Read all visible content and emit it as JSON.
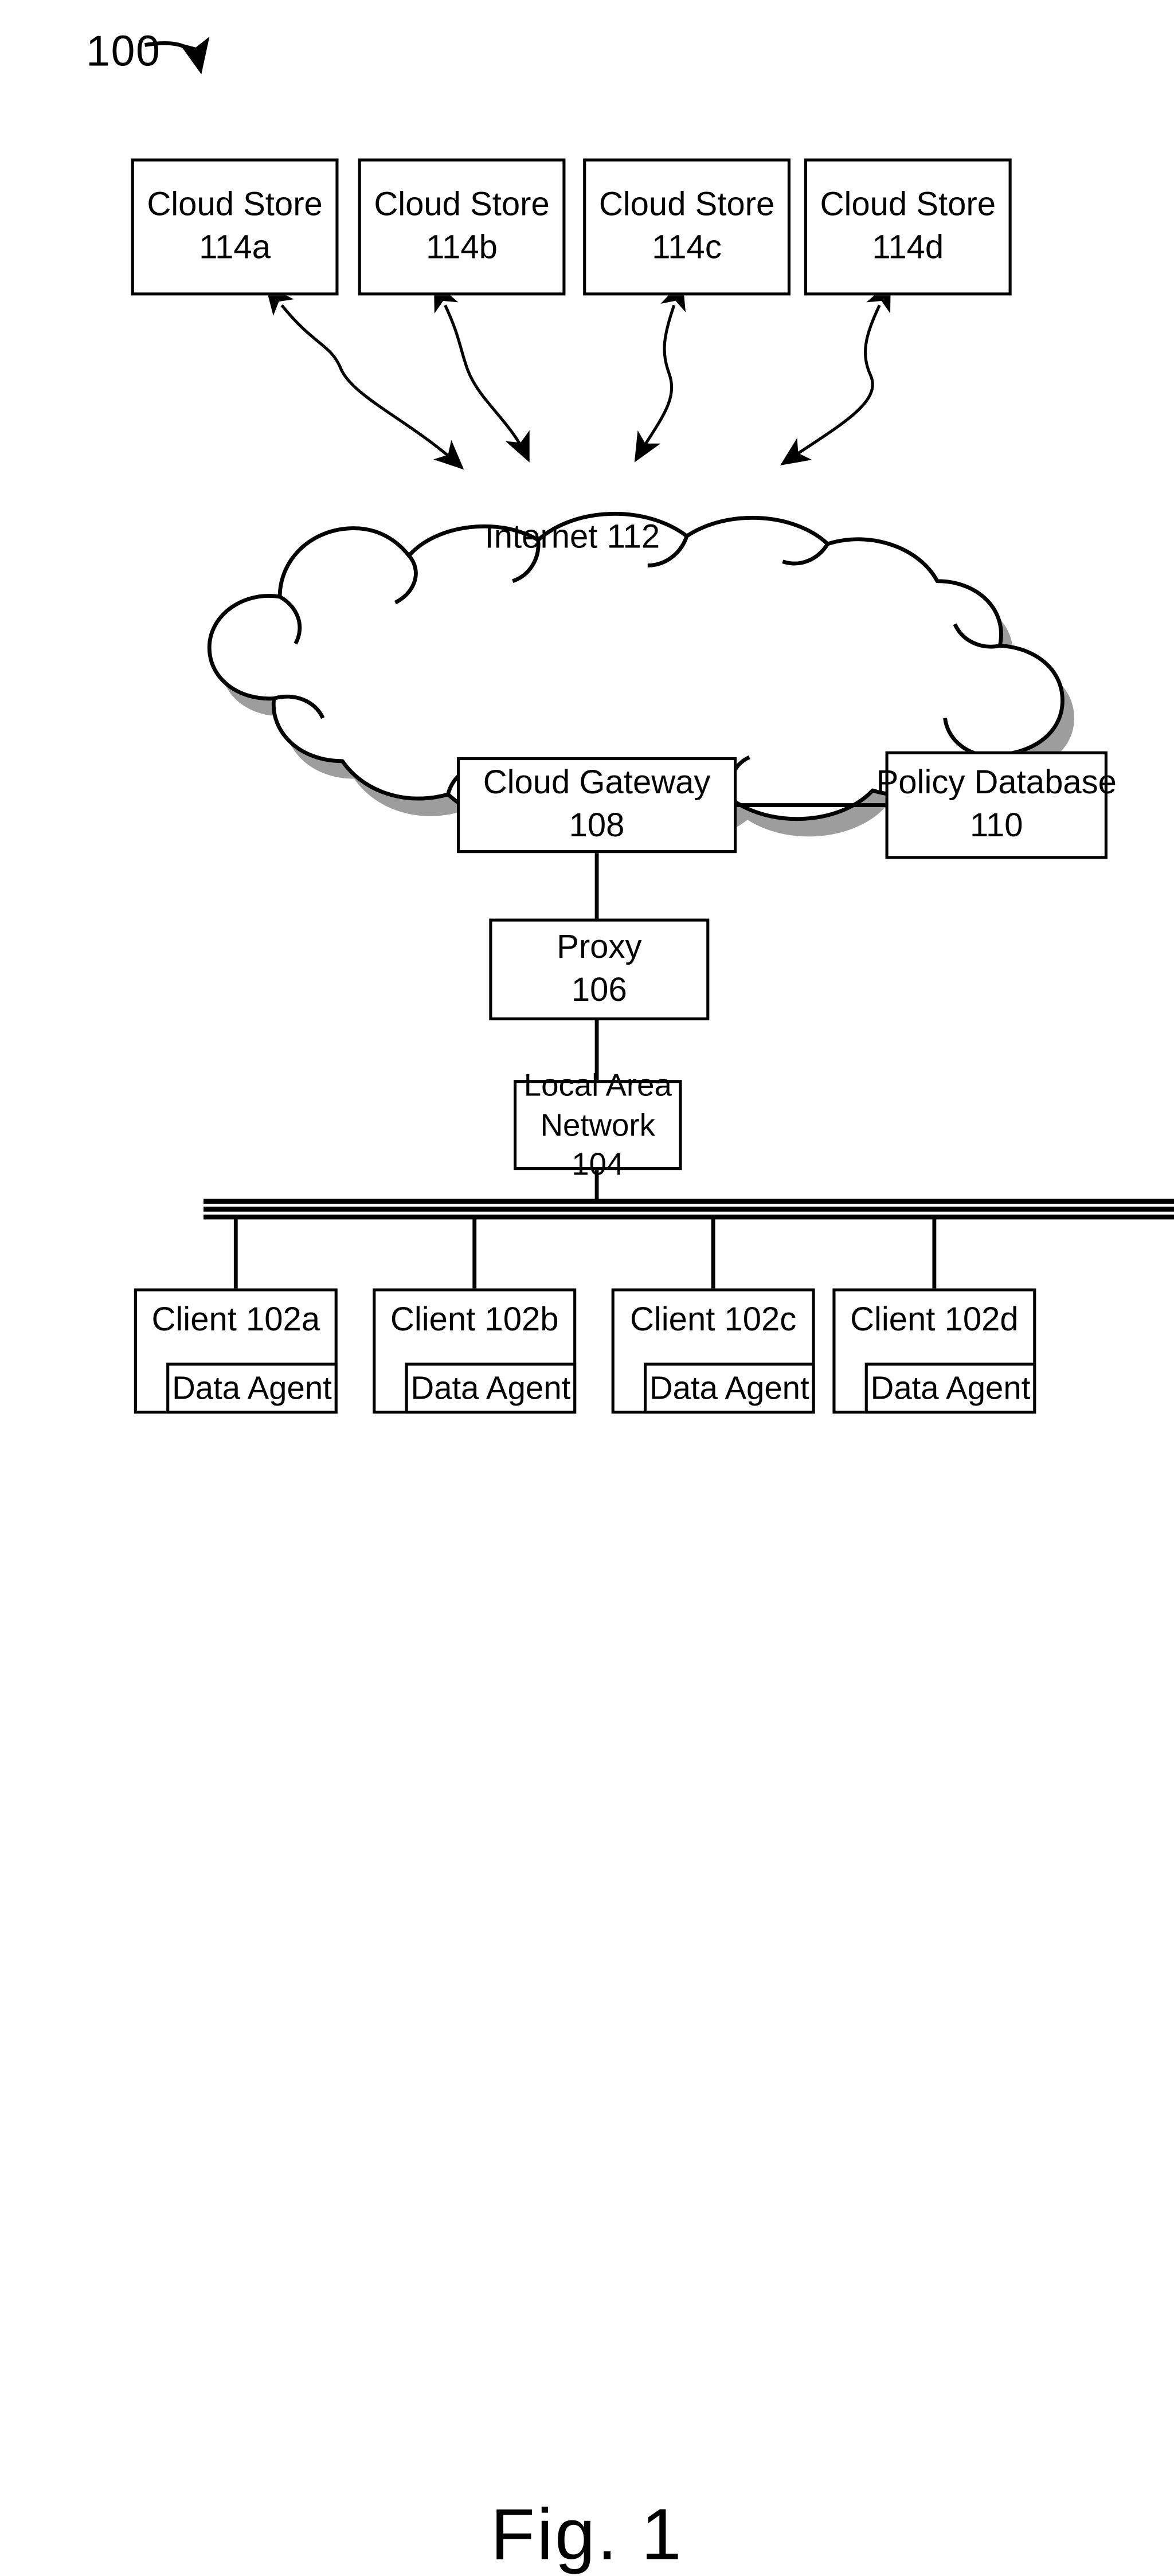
{
  "figure": {
    "reference_numeral": "100",
    "caption": "Fig. 1"
  },
  "cloud_stores": [
    {
      "name": "Cloud Store",
      "numeral": "114a"
    },
    {
      "name": "Cloud Store",
      "numeral": "114b"
    },
    {
      "name": "Cloud Store",
      "numeral": "114c"
    },
    {
      "name": "Cloud Store",
      "numeral": "114d"
    }
  ],
  "internet": {
    "name": "Internet",
    "numeral": "112"
  },
  "gateway": {
    "name": "Cloud Gateway",
    "numeral": "108"
  },
  "policy_database": {
    "name": "Policy Database",
    "numeral": "110"
  },
  "proxy": {
    "name": "Proxy",
    "numeral": "106"
  },
  "local_area_network": {
    "line1": "Local Area",
    "line2": "Network",
    "numeral": "104"
  },
  "clients": [
    {
      "name": "Client",
      "numeral": "102a",
      "agent": "Data Agent"
    },
    {
      "name": "Client",
      "numeral": "102b",
      "agent": "Data Agent"
    },
    {
      "name": "Client",
      "numeral": "102c",
      "agent": "Data Agent"
    },
    {
      "name": "Client",
      "numeral": "102d",
      "agent": "Data Agent"
    }
  ],
  "colors": {
    "stroke": "#000000",
    "fill": "#ffffff",
    "cloud_shadow": "#7f7f7f"
  }
}
